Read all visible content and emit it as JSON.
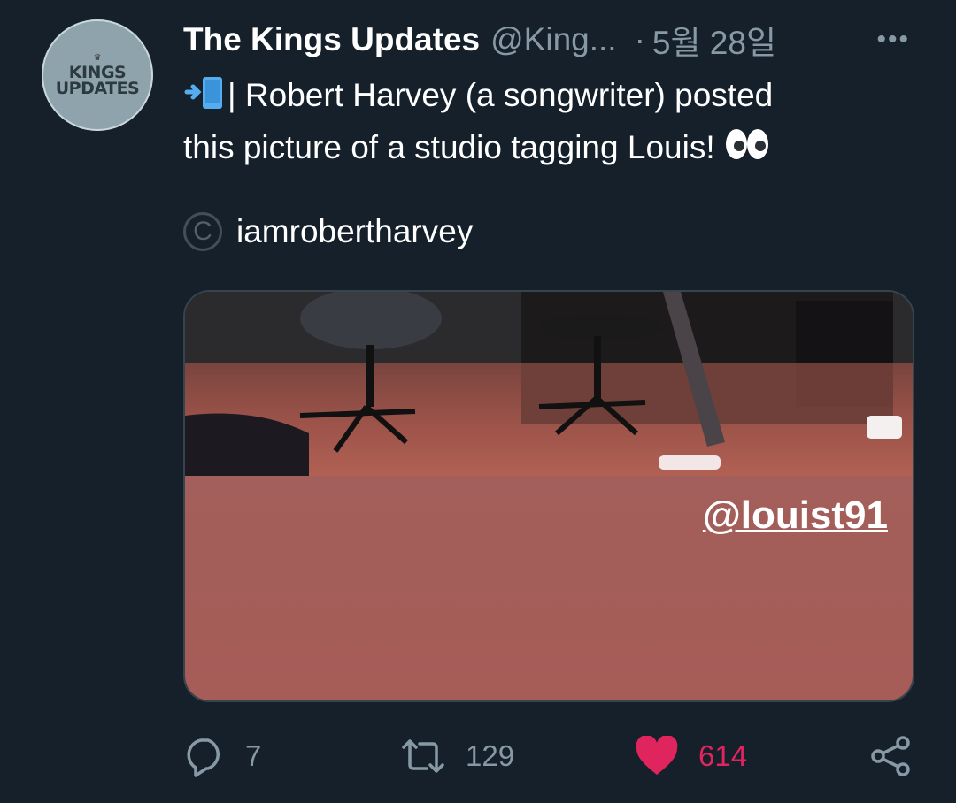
{
  "tweet": {
    "author_name": "The Kings Updates",
    "handle": "@King...",
    "separator": "·",
    "date": "5월 28일",
    "avatar_text": [
      "KINGS",
      "UPDATES"
    ],
    "text_line1": "| Robert Harvey (a songwriter) posted",
    "text_line2": "this picture of a studio tagging Louis!",
    "credit_symbol": "C",
    "credit_text": "iamrobertharvey",
    "media_tag": "@louist91"
  },
  "actions": {
    "replies": "7",
    "retweets": "129",
    "likes": "614"
  },
  "colors": {
    "background": "#15202b",
    "secondary_text": "#8899a6",
    "like": "#e0245e"
  }
}
